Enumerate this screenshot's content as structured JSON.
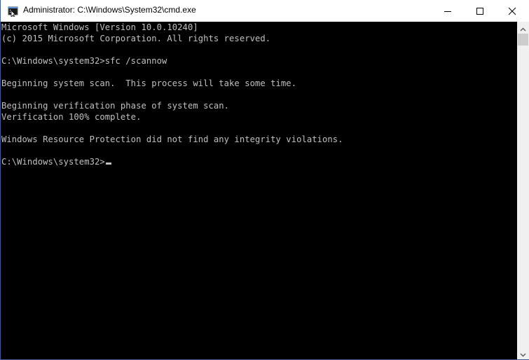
{
  "window": {
    "title": "Administrator: C:\\Windows\\System32\\cmd.exe",
    "icon": "cmd-icon",
    "controls": {
      "minimize": "minimize-icon",
      "maximize": "maximize-icon",
      "close": "close-icon"
    }
  },
  "console": {
    "lines": [
      "Microsoft Windows [Version 10.0.10240]",
      "(c) 2015 Microsoft Corporation. All rights reserved.",
      "",
      "C:\\Windows\\system32>sfc /scannow",
      "",
      "Beginning system scan.  This process will take some time.",
      "",
      "Beginning verification phase of system scan.",
      "Verification 100% complete.",
      "",
      "Windows Resource Protection did not find any integrity violations.",
      "",
      "C:\\Windows\\system32>"
    ],
    "prompt_input": ""
  },
  "scrollbar": {
    "up": "scroll-up-arrow-icon",
    "down": "scroll-down-arrow-icon"
  }
}
